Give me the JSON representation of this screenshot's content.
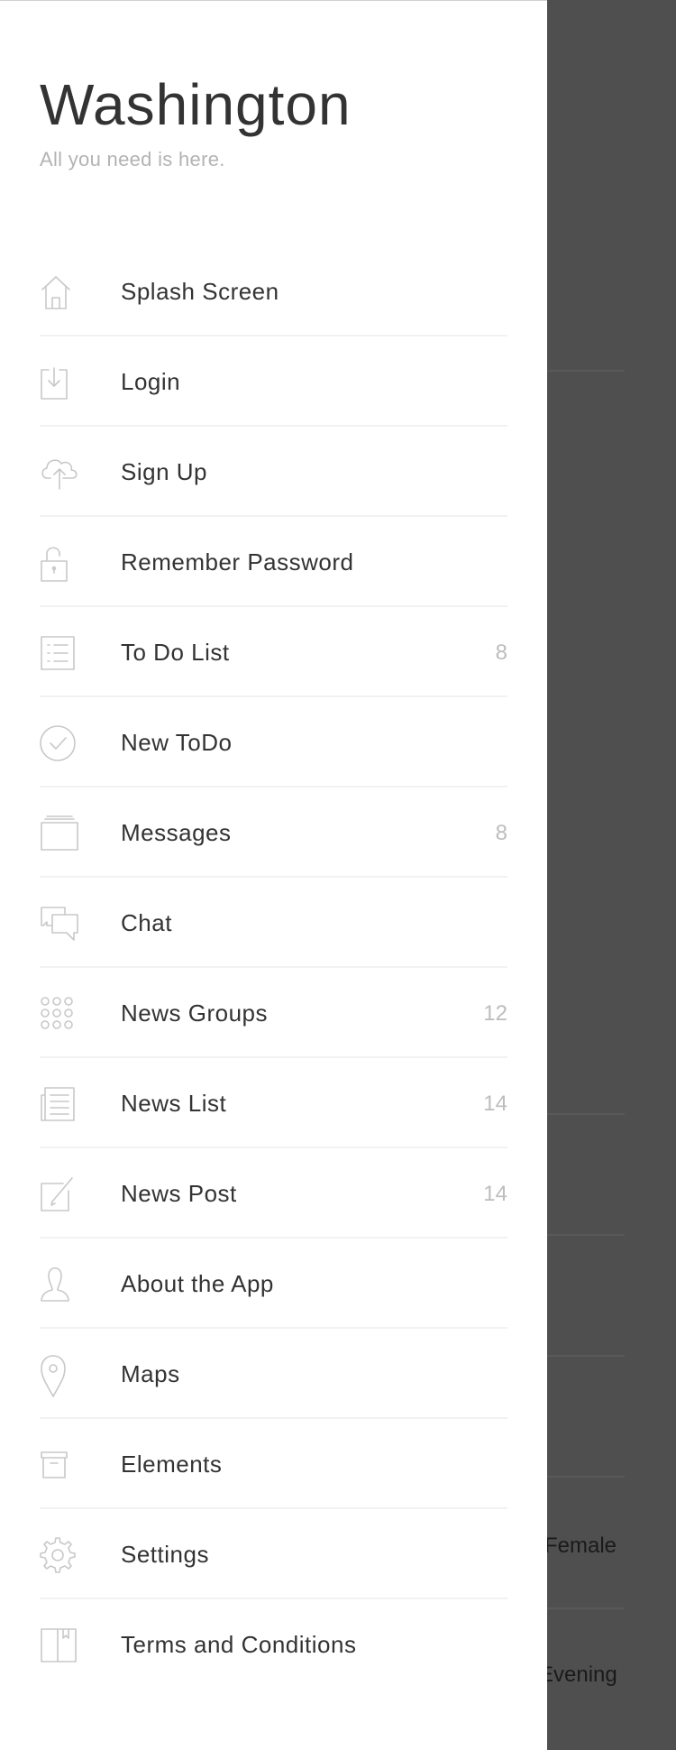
{
  "header": {
    "title": "Washington",
    "subtitle": "All you need is here."
  },
  "menu": [
    {
      "label": "Splash Screen",
      "icon": "home-icon",
      "count": ""
    },
    {
      "label": "Login",
      "icon": "download-icon",
      "count": ""
    },
    {
      "label": "Sign Up",
      "icon": "cloud-upload-icon",
      "count": ""
    },
    {
      "label": "Remember Password",
      "icon": "unlock-icon",
      "count": ""
    },
    {
      "label": "To Do List",
      "icon": "list-icon",
      "count": "8"
    },
    {
      "label": "New ToDo",
      "icon": "check-circle-icon",
      "count": ""
    },
    {
      "label": "Messages",
      "icon": "inbox-icon",
      "count": "8"
    },
    {
      "label": "Chat",
      "icon": "chat-bubbles-icon",
      "count": ""
    },
    {
      "label": "News Groups",
      "icon": "grid-dots-icon",
      "count": "12"
    },
    {
      "label": "News List",
      "icon": "document-list-icon",
      "count": "14"
    },
    {
      "label": "News Post",
      "icon": "edit-icon",
      "count": "14"
    },
    {
      "label": "About the App",
      "icon": "user-icon",
      "count": ""
    },
    {
      "label": "Maps",
      "icon": "map-pin-icon",
      "count": ""
    },
    {
      "label": "Elements",
      "icon": "archive-icon",
      "count": ""
    },
    {
      "label": "Settings",
      "icon": "gear-icon",
      "count": ""
    },
    {
      "label": "Terms and Conditions",
      "icon": "book-icon",
      "count": ""
    }
  ],
  "background": {
    "gender_value": "Female",
    "time_value": "Evening"
  },
  "colors": {
    "overlay": "#4f4f4f",
    "drawer": "#ffffff",
    "text": "#333333",
    "muted": "#b3b3b3",
    "icon": "#c8c8c8"
  }
}
